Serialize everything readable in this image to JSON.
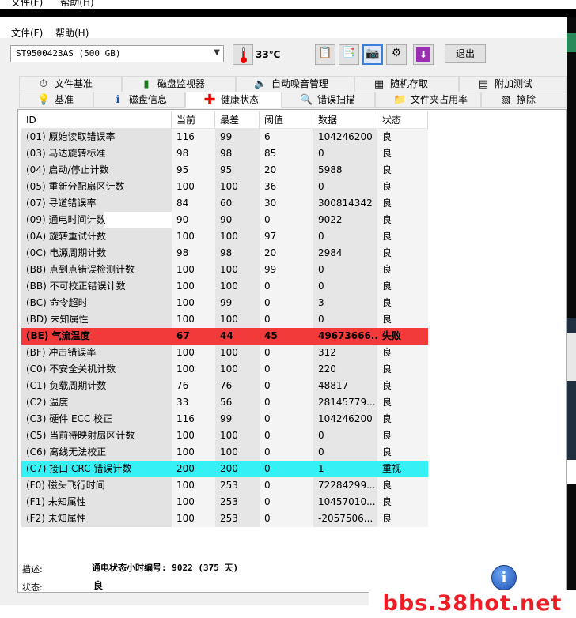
{
  "menu": {
    "file": "文件(F)",
    "help": "帮助(H)"
  },
  "toolbar": {
    "drive": "ST9500423AS (500 GB)",
    "temperature": "33℃",
    "exit_label": "退出",
    "icons": [
      "copy-icon",
      "copy-all-icon",
      "camera-icon",
      "tools-icon",
      "download-icon"
    ]
  },
  "tabs_top": [
    {
      "label": "文件基准",
      "icon": "stopwatch-icon"
    },
    {
      "label": "磁盘监视器",
      "icon": "bar-chart-icon"
    },
    {
      "label": "自动噪音管理",
      "icon": "speaker-icon"
    },
    {
      "label": "随机存取",
      "icon": "random-access-icon"
    },
    {
      "label": "附加测试",
      "icon": "extra-tests-icon"
    }
  ],
  "tabs_bottom": [
    {
      "label": "基准",
      "icon": "lightbulb-icon"
    },
    {
      "label": "磁盘信息",
      "icon": "info-icon"
    },
    {
      "label": "健康状态",
      "icon": "red-cross-icon"
    },
    {
      "label": "错误扫描",
      "icon": "magnifier-icon"
    },
    {
      "label": "文件夹占用率",
      "icon": "folder-icon"
    },
    {
      "label": "擦除",
      "icon": "eraser-icon"
    }
  ],
  "table": {
    "headers": [
      "ID",
      "当前",
      "最差",
      "阈值",
      "数据",
      "状态"
    ],
    "rows": [
      {
        "id": "(01) 原始读取错误率",
        "cur": "116",
        "wor": "99",
        "thr": "6",
        "dat": "104246200",
        "sta": "良"
      },
      {
        "id": "(03) 马达旋转标准",
        "cur": "98",
        "wor": "98",
        "thr": "85",
        "dat": "0",
        "sta": "良"
      },
      {
        "id": "(04) 启动/停止计数",
        "cur": "95",
        "wor": "95",
        "thr": "20",
        "dat": "5988",
        "sta": "良"
      },
      {
        "id": "(05) 重新分配扇区计数",
        "cur": "100",
        "wor": "100",
        "thr": "36",
        "dat": "0",
        "sta": "良"
      },
      {
        "id": "(07) 寻道错误率",
        "cur": "84",
        "wor": "60",
        "thr": "30",
        "dat": "300814342",
        "sta": "良"
      },
      {
        "id": "(09) 通电时间计数",
        "cur": "90",
        "wor": "90",
        "thr": "0",
        "dat": "9022",
        "sta": "良"
      },
      {
        "id": "(0A) 旋转重试计数",
        "cur": "100",
        "wor": "100",
        "thr": "97",
        "dat": "0",
        "sta": "良"
      },
      {
        "id": "(0C) 电源周期计数",
        "cur": "98",
        "wor": "98",
        "thr": "20",
        "dat": "2984",
        "sta": "良"
      },
      {
        "id": "(B8) 点到点错误检测计数",
        "cur": "100",
        "wor": "100",
        "thr": "99",
        "dat": "0",
        "sta": "良"
      },
      {
        "id": "(BB) 不可校正错误计数",
        "cur": "100",
        "wor": "100",
        "thr": "0",
        "dat": "0",
        "sta": "良"
      },
      {
        "id": "(BC) 命令超时",
        "cur": "100",
        "wor": "99",
        "thr": "0",
        "dat": "3",
        "sta": "良"
      },
      {
        "id": "(BD) 未知属性",
        "cur": "100",
        "wor": "100",
        "thr": "0",
        "dat": "0",
        "sta": "良"
      },
      {
        "id": "(BE) 气流温度",
        "cur": "67",
        "wor": "44",
        "thr": "45",
        "dat": "49673666...",
        "sta": "失败"
      },
      {
        "id": "(BF) 冲击错误率",
        "cur": "100",
        "wor": "100",
        "thr": "0",
        "dat": "312",
        "sta": "良"
      },
      {
        "id": "(C0) 不安全关机计数",
        "cur": "100",
        "wor": "100",
        "thr": "0",
        "dat": "220",
        "sta": "良"
      },
      {
        "id": "(C1) 负载周期计数",
        "cur": "76",
        "wor": "76",
        "thr": "0",
        "dat": "48817",
        "sta": "良"
      },
      {
        "id": "(C2) 温度",
        "cur": "33",
        "wor": "56",
        "thr": "0",
        "dat": "28145779...",
        "sta": "良"
      },
      {
        "id": "(C3) 硬件 ECC 校正",
        "cur": "116",
        "wor": "99",
        "thr": "0",
        "dat": "104246200",
        "sta": "良"
      },
      {
        "id": "(C5) 当前待映射扇区计数",
        "cur": "100",
        "wor": "100",
        "thr": "0",
        "dat": "0",
        "sta": "良"
      },
      {
        "id": "(C6) 离线无法校正",
        "cur": "100",
        "wor": "100",
        "thr": "0",
        "dat": "0",
        "sta": "良"
      },
      {
        "id": "(C7) 接口 CRC 错误计数",
        "cur": "200",
        "wor": "200",
        "thr": "0",
        "dat": "1",
        "sta": "重视"
      },
      {
        "id": "(F0) 磁头飞行时间",
        "cur": "100",
        "wor": "253",
        "thr": "0",
        "dat": "72284299...",
        "sta": "良"
      },
      {
        "id": "(F1) 未知属性",
        "cur": "100",
        "wor": "253",
        "thr": "0",
        "dat": "10457010...",
        "sta": "良"
      },
      {
        "id": "(F2) 未知属性",
        "cur": "100",
        "wor": "253",
        "thr": "0",
        "dat": "-2057506...",
        "sta": "良"
      }
    ]
  },
  "description": {
    "label": "描述:",
    "value": "通电状态小时编号: 9022 (375 天)"
  },
  "status": {
    "label": "状态:",
    "value": "良"
  },
  "watermark": "bbs.38hot.net",
  "colors": {
    "fail": "#f23a3a",
    "warning": "#35f0f4"
  }
}
